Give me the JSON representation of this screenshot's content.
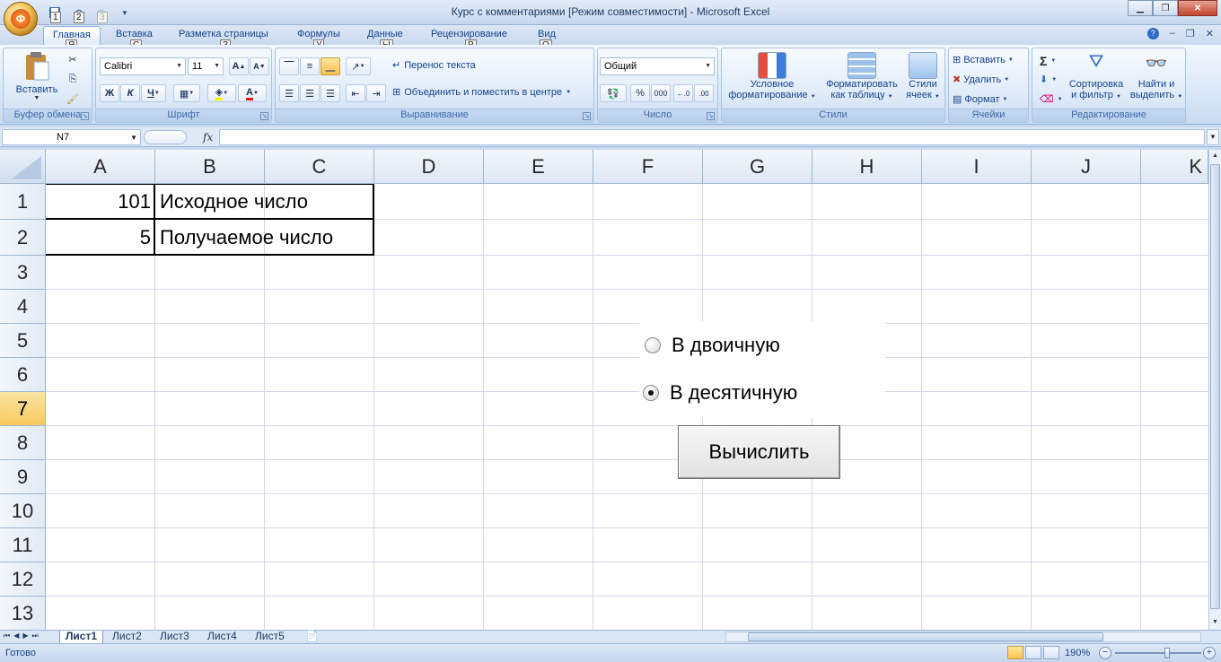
{
  "window": {
    "title": "Курс с комментариями  [Режим совместимости] - Microsoft Excel",
    "office_button_letter": "Ф"
  },
  "quick_access": {
    "keytips": [
      "1",
      "2",
      "3"
    ]
  },
  "ribbon_tabs": [
    {
      "label": "Главная",
      "keytip": "Я",
      "active": true
    },
    {
      "label": "Вставка",
      "keytip": "С"
    },
    {
      "label": "Разметка страницы",
      "keytip": "З"
    },
    {
      "label": "Формулы",
      "keytip": "У"
    },
    {
      "label": "Данные",
      "keytip": "Ы"
    },
    {
      "label": "Рецензирование",
      "keytip": "Р"
    },
    {
      "label": "Вид",
      "keytip": "О"
    }
  ],
  "ribbon": {
    "clipboard": {
      "group_label": "Буфер обмена",
      "paste_label": "Вставить"
    },
    "font": {
      "group_label": "Шрифт",
      "font_name": "Calibri",
      "font_size": "11",
      "bold": "Ж",
      "italic": "К",
      "underline": "Ч"
    },
    "alignment": {
      "group_label": "Выравнивание",
      "wrap_text": "Перенос текста",
      "merge_center": "Объединить и поместить в центре"
    },
    "number": {
      "group_label": "Число",
      "format": "Общий",
      "percent": "%",
      "thousands": "000"
    },
    "styles": {
      "group_label": "Стили",
      "conditional_1": "Условное",
      "conditional_2": "форматирование",
      "format_table_1": "Форматировать",
      "format_table_2": "как таблицу",
      "cell_styles_1": "Стили",
      "cell_styles_2": "ячеек"
    },
    "cells": {
      "group_label": "Ячейки",
      "insert": "Вставить",
      "delete": "Удалить",
      "format": "Формат"
    },
    "editing": {
      "group_label": "Редактирование",
      "sort_1": "Сортировка",
      "sort_2": "и фильтр",
      "find_1": "Найти и",
      "find_2": "выделить"
    }
  },
  "formula_bar": {
    "name_box": "N7",
    "fx": "fx",
    "formula": ""
  },
  "columns": [
    "A",
    "B",
    "C",
    "D",
    "E",
    "F",
    "G",
    "H",
    "I",
    "J",
    "K"
  ],
  "rows": [
    "1",
    "2",
    "3",
    "4",
    "5",
    "6",
    "7",
    "8",
    "9",
    "10",
    "11",
    "12",
    "13"
  ],
  "selected_row": "7",
  "cells": {
    "A1": "101",
    "B1": "Исходное число",
    "A2": "5",
    "B2": "Получаемое число"
  },
  "form_controls": {
    "radio_binary": {
      "label": "В двоичную",
      "checked": false
    },
    "radio_decimal": {
      "label": "В десятичную",
      "checked": true
    },
    "calculate_button": "Вычислить"
  },
  "sheet_tabs": [
    {
      "label": "Лист1",
      "active": true
    },
    {
      "label": "Лист2"
    },
    {
      "label": "Лист3"
    },
    {
      "label": "Лист4"
    },
    {
      "label": "Лист5"
    }
  ],
  "status": {
    "text": "Готово",
    "zoom": "190%"
  }
}
